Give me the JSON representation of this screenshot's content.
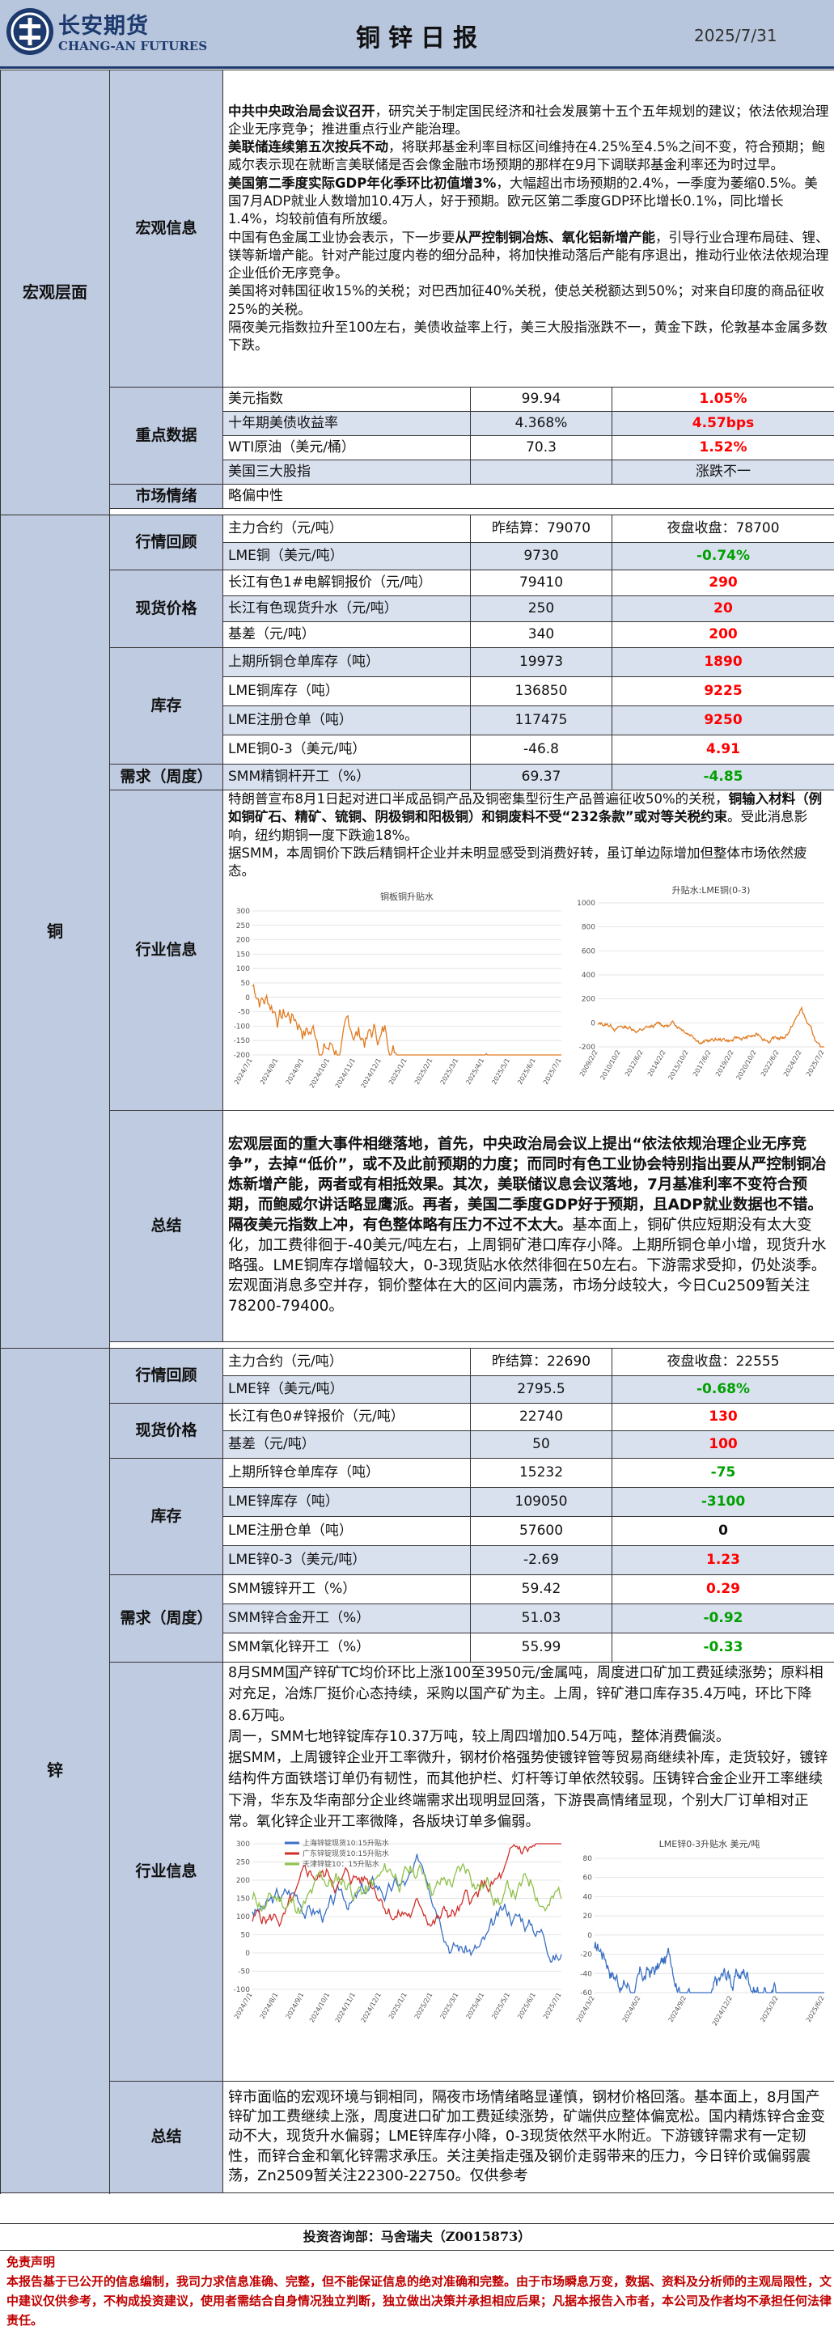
{
  "header": {
    "brand_cn": "长安期货",
    "brand_en": "CHANG-AN FUTURES",
    "title": "铜锌日报",
    "date": "2025/7/31"
  },
  "macro": {
    "section": "宏观层面",
    "news_label": "宏观信息",
    "news": [
      {
        "bold": "中共中央政治局会议召开",
        "text": "，研究关于制定国民经济和社会发展第十五个五年规划的建议；依法依规治理企业无序竞争；推进重点行业产能治理。"
      },
      {
        "bold": "美联储连续第五次按兵不动",
        "text": "，将联邦基金利率目标区间维持在4.25%至4.5%之间不变，符合预期；鲍威尔表示现在就断言美联储是否会像金融市场预期的那样在9月下调联邦基金利率还为时过早。"
      },
      {
        "bold": "美国第二季度实际GDP年化季环比初值增3%",
        "text": "，大幅超出市场预期的2.4%，一季度为萎缩0.5%。美国7月ADP就业人数增加10.4万人，好于预期。欧元区第二季度GDP环比增长0.1%，同比增长1.4%，均较前值有所放缓。"
      },
      {
        "pre": "中国有色金属工业协会表示，下一步要",
        "bold": "从严控制铜冶炼、氧化铝新增产能",
        "text": "，引导行业合理布局硅、锂、镁等新增产能。针对产能过度内卷的细分品种，将加快推动落后产能有序退出，推动行业依法依规治理企业低价无序竞争。"
      },
      {
        "text": "美国将对韩国征收15%的关税；对巴西加征40%关税，使总关税额达到50%；对来自印度的商品征收25%的关税。"
      },
      {
        "text": "隔夜美元指数拉升至100左右，美债收益率上行，美三大股指涨跌不一，黄金下跌，伦敦基本金属多数下跌。"
      }
    ],
    "key_label": "重点数据",
    "key_rows": [
      {
        "name": "美元指数",
        "value": "99.94",
        "change": "1.05%",
        "color": "red"
      },
      {
        "name": "十年期美债收益率",
        "value": "4.368%",
        "change": "4.57bps",
        "color": "red"
      },
      {
        "name": "WTI原油（美元/桶）",
        "value": "70.3",
        "change": "1.52%",
        "color": "red"
      },
      {
        "name": "美国三大股指",
        "value": "",
        "change": "涨跌不一",
        "color": "blk"
      }
    ],
    "sentiment_label": "市场情绪",
    "sentiment": "略偏中性"
  },
  "copper": {
    "section": "铜",
    "quote_label": "行情回顾",
    "quote_rows": [
      {
        "name": "主力合约（元/吨）",
        "c2": "昨结算：79070",
        "c3": "夜盘收盘：78700",
        "c3color": "blk"
      },
      {
        "name": "LME铜（美元/吨）",
        "c2": "9730",
        "c3": "-0.74%",
        "c3color": "green"
      }
    ],
    "spot_label": "现货价格",
    "spot_rows": [
      {
        "name": "长江有色1#电解铜报价（元/吨）",
        "value": "79410",
        "change": "290",
        "color": "red"
      },
      {
        "name": "长江有色现货升水（元/吨）",
        "value": "250",
        "change": "20",
        "color": "red"
      },
      {
        "name": "基差（元/吨）",
        "value": "340",
        "change": "200",
        "color": "red"
      }
    ],
    "inv_label": "库存",
    "inv_rows": [
      {
        "name": "上期所铜仓单库存（吨）",
        "value": "19973",
        "change": "1890",
        "color": "red"
      },
      {
        "name": "LME铜库存（吨）",
        "value": "136850",
        "change": "9225",
        "color": "red"
      },
      {
        "name": "LME注册仓单（吨）",
        "value": "117475",
        "change": "9250",
        "color": "red"
      },
      {
        "name": "LME铜0-3（美元/吨）",
        "value": "-46.8",
        "change": "4.91",
        "color": "red"
      }
    ],
    "demand_label": "需求（周度）",
    "demand_rows": [
      {
        "name": "SMM精铜杆开工（%）",
        "value": "69.37",
        "change": "-4.85",
        "color": "green"
      }
    ],
    "industry_label": "行业信息",
    "industry": [
      {
        "text": "特朗普宣布8月1日起对进口半成品铜产品及铜密集型衍生产品普遍征收50%的关税，",
        "bold": "铜输入材料（例如铜矿石、精矿、锍铜、阴极铜和阳极铜）和铜废料不受“232条款”或对等关税约束",
        "tail": "。受此消息影响，纽约期铜一度下跌逾18%。"
      },
      {
        "text": "据SMM，本周铜价下跌后精铜杆企业并未明显感受到消费好转，虽订单边际增加但整体市场依然疲态。"
      }
    ],
    "chart1_title": "铜板铜升贴水",
    "chart2_title": "升贴水:LME铜(0-3)",
    "chart1_xticks": [
      "2024/7/1",
      "2024/8/1",
      "2024/9/1",
      "2024/10/1",
      "2024/11/1",
      "2024/12/1",
      "2025/1/1",
      "2025/2/1",
      "2025/3/1",
      "2025/4/1",
      "2025/5/1",
      "2025/6/1",
      "2025/7/1"
    ],
    "chart2_xticks": [
      "2009/2/2",
      "2010/10/2",
      "2012/6/2",
      "2014/2/2",
      "2015/10/2",
      "2017/6/2",
      "2019/2/2",
      "2020/10/2",
      "2022/6/2",
      "2024/2/2",
      "2025/7/2"
    ],
    "chart1_yticks": [
      "300",
      "250",
      "200",
      "150",
      "100",
      "50",
      "0",
      "-50",
      "-100",
      "-150",
      "-200"
    ],
    "chart2_yticks": [
      "1000",
      "800",
      "600",
      "400",
      "200",
      "0",
      "-200"
    ],
    "summary_label": "总结",
    "summary_bold": "宏观层面的重大事件相继落地，首先，中央政治局会议上提出“依法依规治理企业无序竞争”，去掉“低价”，或不及此前预期的力度；而同时有色工业协会特别指出要从严控制铜冶炼新增产能，两者或有相抵效果。其次，美联储议息会议落地，7月基准利率不变符合预期，而鲍威尔讲话略显鹰派。再者，美国二季度GDP好于预期，且ADP就业数据也不错。隔夜美元指数上冲，有色整体略有压力不过不太大。",
    "summary_text": "基本面上，铜矿供应短期没有太大变化，加工费徘徊于-40美元/吨左右，上周铜矿港口库存小降。上期所铜仓单小增，现货升水略强。LME铜库存增幅较大，0-3现货贴水依然徘徊在50左右。下游需求受抑，仍处淡季。宏观面消息多空并存，铜价整体在大的区间内震荡，市场分歧较大，今日Cu2509暂关注78200-79400。"
  },
  "zinc": {
    "section": "锌",
    "quote_label": "行情回顾",
    "quote_rows": [
      {
        "name": "主力合约（元/吨）",
        "c2": "昨结算：22690",
        "c3": "夜盘收盘：22555",
        "c3color": "blk"
      },
      {
        "name": "LME锌（美元/吨）",
        "c2": "2795.5",
        "c3": "-0.68%",
        "c3color": "green"
      }
    ],
    "spot_label": "现货价格",
    "spot_rows": [
      {
        "name": "长江有色0#锌报价（元/吨）",
        "value": "22740",
        "change": "130",
        "color": "red"
      },
      {
        "name": "基差（元/吨）",
        "value": "50",
        "change": "100",
        "color": "red"
      }
    ],
    "inv_label": "库存",
    "inv_rows": [
      {
        "name": "上期所锌仓单库存（吨）",
        "value": "15232",
        "change": "-75",
        "color": "green"
      },
      {
        "name": "LME锌库存（吨）",
        "value": "109050",
        "change": "-3100",
        "color": "green"
      },
      {
        "name": "LME注册仓单（吨）",
        "value": "57600",
        "change": "0",
        "color": "blk"
      },
      {
        "name": "LME锌0-3（美元/吨）",
        "value": "-2.69",
        "change": "1.23",
        "color": "red"
      }
    ],
    "demand_label": "需求（周度）",
    "demand_rows": [
      {
        "name": "SMM镀锌开工（%）",
        "value": "59.42",
        "change": "0.29",
        "color": "red"
      },
      {
        "name": "SMM锌合金开工（%）",
        "value": "51.03",
        "change": "-0.92",
        "color": "green"
      },
      {
        "name": "SMM氧化锌开工（%）",
        "value": "55.99",
        "change": "-0.33",
        "color": "green"
      }
    ],
    "industry_label": "行业信息",
    "industry": [
      {
        "text": "8月SMM国产锌矿TC均价环比上涨100至3950元/金属吨，周度进口矿加工费延续涨势；原料相对充足，冶炼厂挺价心态持续，采购以国产矿为主。上周，锌矿港口库存35.4万吨，环比下降8.6万吨。"
      },
      {
        "text": "周一，SMM七地锌锭库存10.37万吨，较上周四增加0.54万吨，整体消费偏淡。"
      },
      {
        "text": "据SMM，上周镀锌企业开工率微升，钢材价格强势使镀锌管等贸易商继续补库，走货较好，镀锌结构件方面铁塔订单仍有韧性，而其他护栏、灯杆等订单依然较弱。压铸锌合金企业开工率继续下滑，华东及华南部分企业终端需求出现明显回落，下游畏高情绪显现，个别大厂订单相对正常。氧化锌企业开工率微降，各版块订单多偏弱。"
      }
    ],
    "chart3_legend": [
      "上海锌锭现货10:15升贴水",
      "广东锌锭现货10:15升贴水",
      "天津锌锭10：15升贴水"
    ],
    "chart4_title": "LME锌0-3升贴水 美元/吨",
    "chart3_yticks": [
      "300",
      "250",
      "200",
      "150",
      "100",
      "50",
      "0",
      "-50",
      "-100"
    ],
    "chart4_yticks": [
      "80",
      "60",
      "40",
      "20",
      "0",
      "-20",
      "-40",
      "-60"
    ],
    "chart3_xticks": [
      "2024/7/1",
      "2024/8/1",
      "2024/9/1",
      "2024/10/1",
      "2024/11/1",
      "2024/12/1",
      "2025/1/1",
      "2025/2/1",
      "2025/3/1",
      "2025/4/1",
      "2025/5/1",
      "2025/6/1",
      "2025/7/1"
    ],
    "chart4_xticks": [
      "2024/3/2",
      "2024/6/2",
      "2024/9/2",
      "2024/12/2",
      "2025/3/2",
      "2025/6/2"
    ],
    "summary_label": "总结",
    "summary": "锌市面临的宏观环境与铜相同，隔夜市场情绪略显谨慎，钢材价格回落。基本面上，8月国产锌矿加工费继续上涨，周度进口矿加工费延续涨势，矿端供应整体偏宽松。国内精炼锌合金变动不大，现货升水偏弱；LME锌库存小降，0-3现货依然平水附近。下游镀锌需求有一定韧性，而锌合金和氧化锌需求承压。关注美指走强及钢价走弱带来的压力，今日锌价或偏弱震荡，Zn2509暂关注22300-22750。仅供参考"
  },
  "contact": "投资咨询部：马舍瑞夫（Z0015873）",
  "disclaimer_title": "免责声明",
  "disclaimer": "本报告基于已公开的信息编制，我司力求信息准确、完整，但不能保证信息的绝对准确和完整。由于市场瞬息万变，数据、资料及分析师的主观局限性，文中建议仅供参考，不构成投资建议，使用者需结合自身情况独立判断，独立做出决策并承担相应后果；凡据本报告入市者，本公司及作者均不承担任何法律责任。",
  "colors": {
    "header_bg": "#b7c6dd",
    "section_bg": "#bfcbe0",
    "up": "#ff0000",
    "down": "#00a000",
    "navy": "#1d3a6e"
  }
}
